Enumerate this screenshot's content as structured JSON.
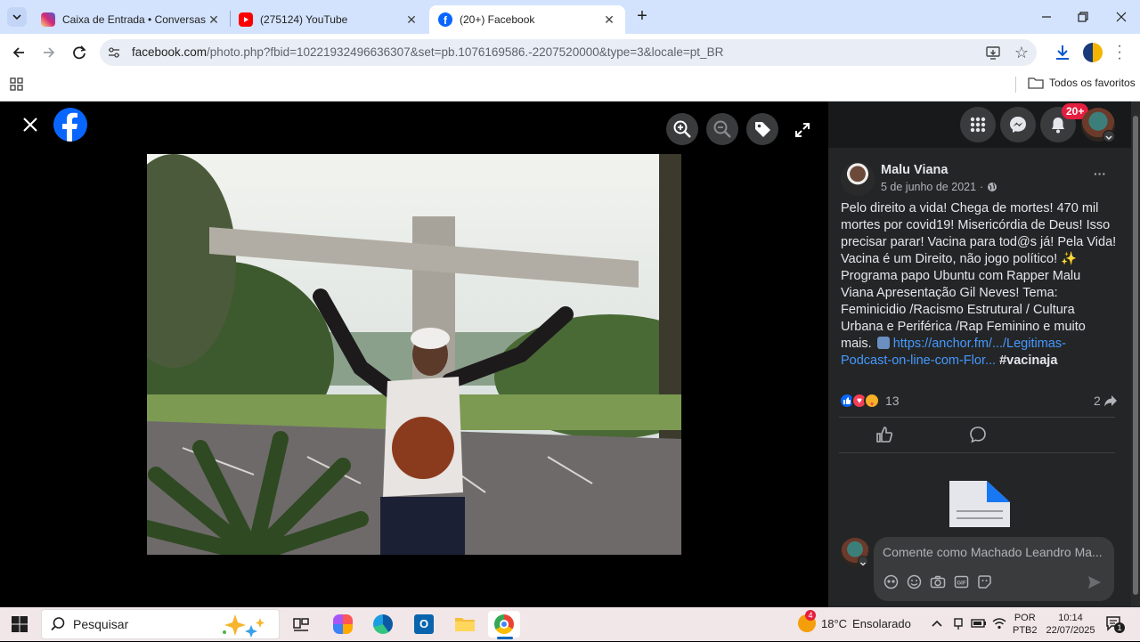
{
  "browser": {
    "tabs": [
      {
        "title": "Caixa de Entrada • Conversas",
        "active": false
      },
      {
        "title": "(275124) YouTube",
        "active": false
      },
      {
        "title": "(20+) Facebook",
        "active": true
      }
    ],
    "new_tab": "+",
    "url_domain": "facebook.com",
    "url_rest": "/photo.php?fbid=10221932496636307&set=pb.1076169586.-2207520000&type=3&locale=pt_BR",
    "bookmarks_label": "Todos os favoritos"
  },
  "facebook": {
    "notifications_badge": "20+",
    "post": {
      "author": "Malu Viana",
      "date": "5 de junho de 2021",
      "separator": "·",
      "text": "Pelo direito a vida! Chega de mortes! 470 mil mortes por covid19! Misericórdia de Deus! Isso precisar parar! Vacina para tod@s já! Pela Vida! Vacina é um Direito, não jogo político! ✨ Programa papo Ubuntu com Rapper Malu Viana Apresentação Gil Neves! Tema: Feminicidio /Racismo Estrutural / Cultura Urbana e Periférica /Rap Feminino e muito mais.",
      "link": "https://anchor.fm/.../Legitimas-Podcast-on-line-com-Flor...",
      "hashtag": "#vacinaja",
      "reactions_count": "13",
      "shares_count": "2",
      "more": "···"
    },
    "comment_placeholder": "Comente como Machado Leandro Ma..."
  },
  "taskbar": {
    "search_placeholder": "Pesquisar",
    "weather_temp": "18°C",
    "weather_desc": "Ensolarado",
    "weather_badge": "4",
    "lang_top": "POR",
    "lang_bottom": "PTB2",
    "time": "10:14",
    "date": "22/07/2025",
    "notif_count": "1"
  },
  "colors": {
    "fb_blue": "#0866ff",
    "link_blue": "#4599ff",
    "badge_red": "#e41e3f"
  }
}
